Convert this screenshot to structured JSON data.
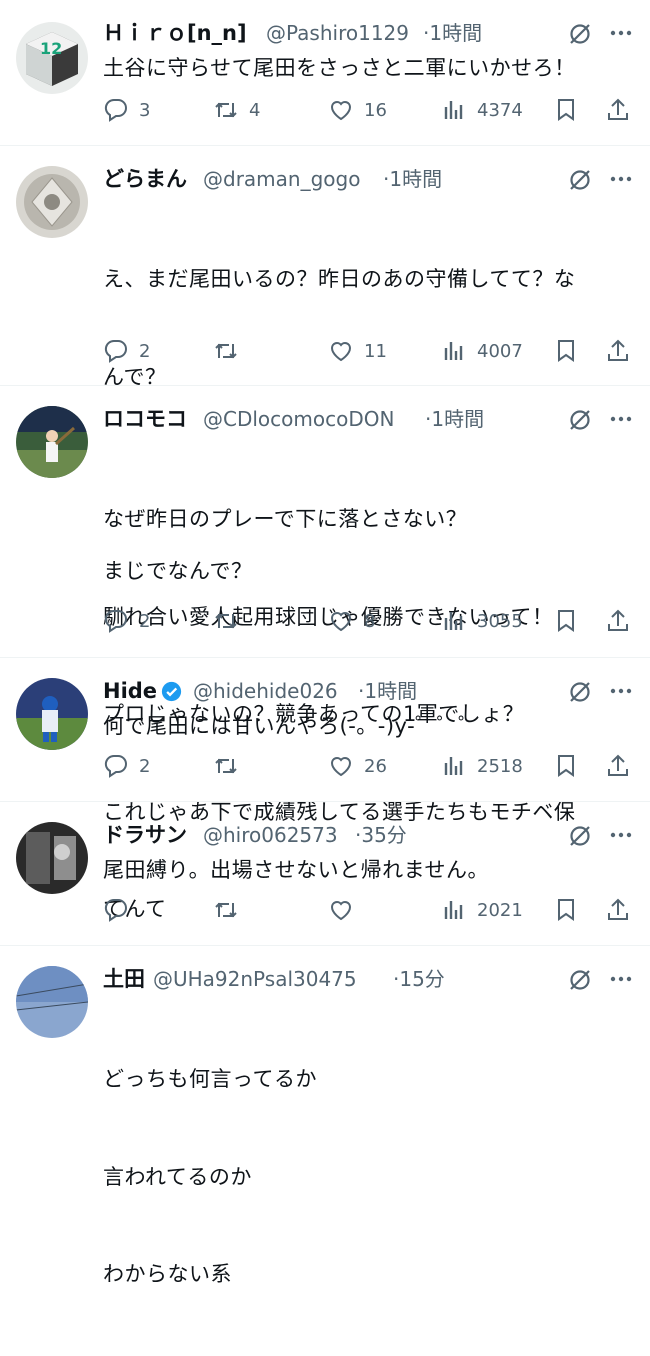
{
  "tweets": [
    {
      "name": "Ｈｉｒｏ[n_n]",
      "handle": "@Pashiro1129",
      "time": "·1時間",
      "text": "土谷に守らせて尾田をさっさと二軍にいかせろ！",
      "replies": "3",
      "retweets": "4",
      "likes": "16",
      "views": "4374"
    },
    {
      "name": "どらまん",
      "handle": "@draman_gogo",
      "time": "·1時間",
      "text": "え、まだ尾田いるの？昨日のあの守備しててなんで？\n\nまじでなんで？",
      "text_lines": [
        "え、まだ尾田いるの？昨日のあの守備してて？な",
        "んで？",
        "",
        "まじでなんで？"
      ],
      "replies": "2",
      "retweets": "",
      "likes": "11",
      "views": "4007"
    },
    {
      "name": "ロコモコ",
      "handle": "@CDlocomocoDON",
      "time": "·1時間",
      "text_lines": [
        "なぜ昨日のプレーで下に落とさない？",
        "馴れ合い愛人起用球団じゃ優勝できないって！",
        "プロじゃないの？競争あっての1軍でしょ？",
        "これじゃあ下で成績残してる選手たちもモチベ保",
        "てんて"
      ],
      "replies": "2",
      "retweets": "",
      "likes": "8",
      "views": "3055"
    },
    {
      "name": "Hide",
      "handle": "@hidehide026",
      "time": "·1時間",
      "text": "何で尾田には甘いんやろ(-。-)y-゜゜゜",
      "replies": "2",
      "retweets": "",
      "likes": "26",
      "views": "2518"
    },
    {
      "name": "ドラサン",
      "handle": "@hiro062573",
      "time": "·35分",
      "text": "尾田縛り。出場させないと帰れません。",
      "replies": "",
      "retweets": "",
      "likes": "",
      "views": "2021"
    },
    {
      "name": "土田",
      "handle": "@UHa92nPsal30475",
      "time": "·15分",
      "text_lines": [
        "どっちも何言ってるか",
        "言われてるのか",
        "わからない系"
      ],
      "replies": "",
      "retweets": "",
      "likes": "",
      "views": ""
    }
  ],
  "icons": [
    "reply-icon",
    "retweet-icon",
    "like-icon",
    "views-icon",
    "bookmark-icon",
    "share-icon",
    "grok-icon",
    "more-icon",
    "verified-icon"
  ],
  "colors": {
    "text": "#0f1419",
    "secondary": "#536471",
    "verified": "#1d9bf0",
    "divider": "#eff3f4"
  }
}
